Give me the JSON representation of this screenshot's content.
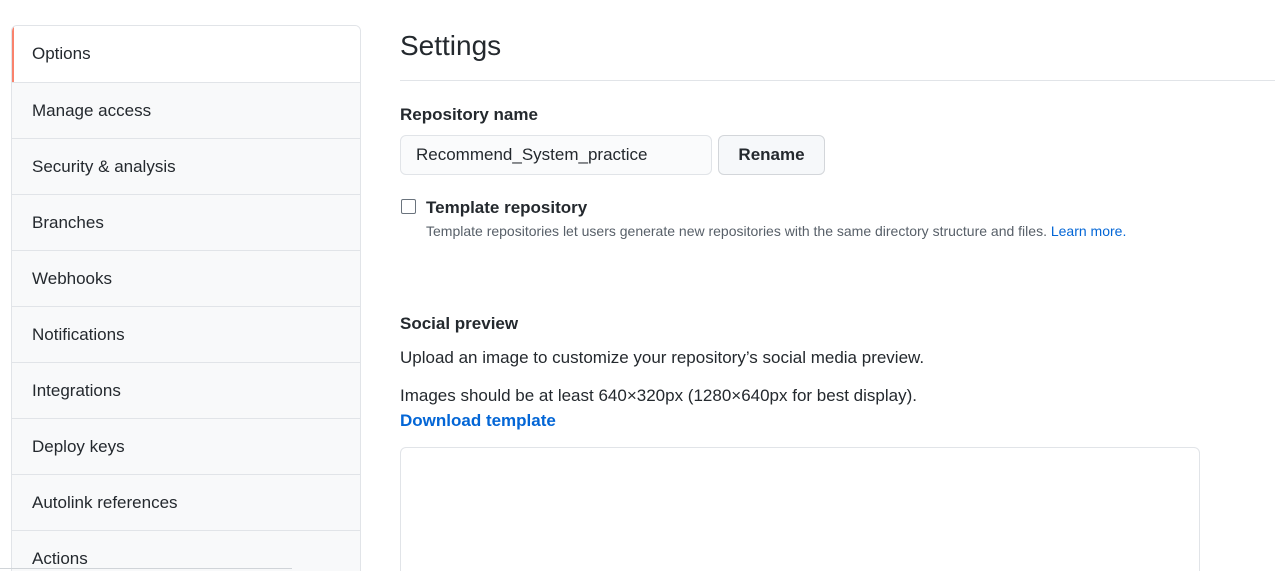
{
  "sidebar": {
    "items": [
      {
        "label": "Options",
        "active": true
      },
      {
        "label": "Manage access"
      },
      {
        "label": "Security & analysis"
      },
      {
        "label": "Branches"
      },
      {
        "label": "Webhooks"
      },
      {
        "label": "Notifications"
      },
      {
        "label": "Integrations"
      },
      {
        "label": "Deploy keys"
      },
      {
        "label": "Autolink references"
      },
      {
        "label": "Actions"
      }
    ]
  },
  "main": {
    "title": "Settings",
    "repo_name": {
      "label": "Repository name",
      "value": "Recommend_System_practice",
      "rename_label": "Rename"
    },
    "template": {
      "label": "Template repository",
      "checked": false,
      "note": "Template repositories let users generate new repositories with the same directory structure and files.",
      "learn_more": "Learn more."
    },
    "social_preview": {
      "heading": "Social preview",
      "description": "Upload an image to customize your repository’s social media preview.",
      "size_hint": "Images should be at least 640×320px (1280×640px for best display).",
      "download_label": "Download template"
    }
  },
  "colors": {
    "accent_active": "#f9826c",
    "link": "#0366d6",
    "border": "#e1e4e8"
  }
}
